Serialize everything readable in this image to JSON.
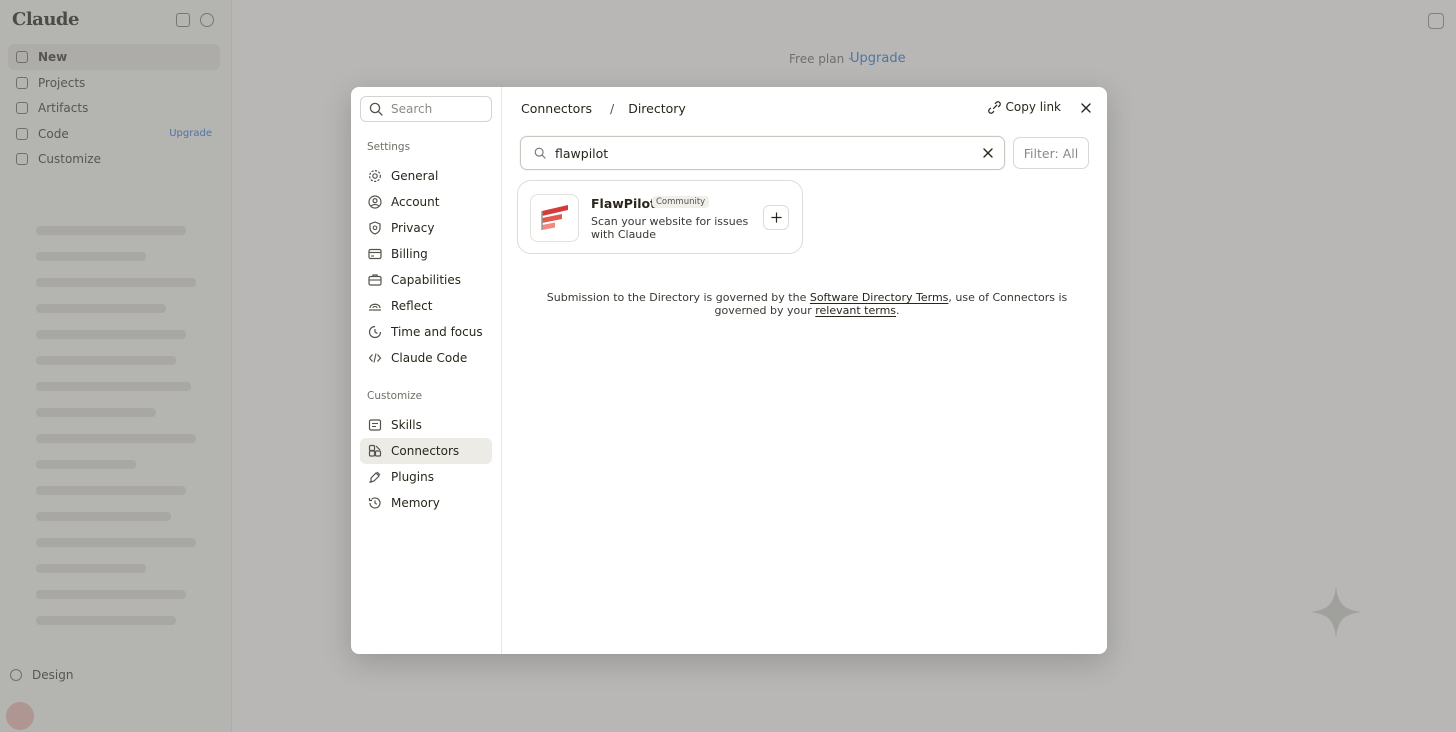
{
  "background": {
    "logo": "Claude",
    "nav": [
      {
        "label": "New"
      },
      {
        "label": "Projects"
      },
      {
        "label": "Artifacts"
      },
      {
        "label": "Code",
        "tag": "Upgrade"
      },
      {
        "label": "Customize"
      }
    ],
    "design_label": "Design",
    "plan_label": "Free plan ·",
    "upgrade_label": "Upgrade"
  },
  "settings": {
    "search_placeholder": "Search",
    "section_settings": "Settings",
    "settings_items": [
      {
        "label": "General",
        "icon": "gear-icon"
      },
      {
        "label": "Account",
        "icon": "account-icon"
      },
      {
        "label": "Privacy",
        "icon": "shield-icon"
      },
      {
        "label": "Billing",
        "icon": "card-icon"
      },
      {
        "label": "Capabilities",
        "icon": "briefcase-icon"
      },
      {
        "label": "Reflect",
        "icon": "reflect-icon"
      },
      {
        "label": "Time and focus",
        "icon": "clock-icon"
      },
      {
        "label": "Claude Code",
        "icon": "code-icon"
      }
    ],
    "section_customize": "Customize",
    "customize_items": [
      {
        "label": "Skills",
        "icon": "skills-icon"
      },
      {
        "label": "Connectors",
        "icon": "connectors-icon",
        "active": true
      },
      {
        "label": "Plugins",
        "icon": "plugin-icon"
      },
      {
        "label": "Memory",
        "icon": "memory-icon"
      }
    ]
  },
  "header": {
    "crumb_1": "Connectors",
    "separator": "/",
    "crumb_2": "Directory",
    "copy_link": "Copy link"
  },
  "filter": {
    "value": "flawpilot",
    "filter_label": "Filter: All"
  },
  "results": [
    {
      "title": "FlawPilot",
      "badge": "Community",
      "description": "Scan your website for issues with Claude"
    }
  ],
  "footnote": {
    "prefix": "Submission to the Directory is governed by the ",
    "link_1": "Software Directory Terms",
    "middle": ", use of Connectors is governed by your ",
    "link_2": "relevant terms",
    "suffix": "."
  },
  "colors": {
    "accent_blue": "#2c6fd0",
    "active_item_bg": "#ecebe6",
    "logo_red": "#d63b3b"
  }
}
